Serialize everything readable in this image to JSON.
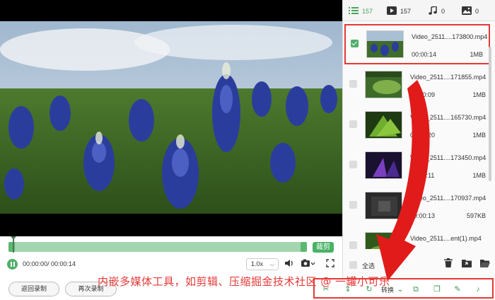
{
  "player": {
    "trim_label": "裁剪",
    "time_display": "00:00:00/ 00:00:14",
    "speed_value": "1.0x",
    "speed_caret": "⌵"
  },
  "buttons": {
    "back_record": "返回录制",
    "record_again": "再次录制"
  },
  "panel": {
    "tabs": [
      {
        "name": "all",
        "count": "157"
      },
      {
        "name": "video",
        "count": "157"
      },
      {
        "name": "audio",
        "count": "0"
      },
      {
        "name": "image",
        "count": "0"
      }
    ],
    "items": [
      {
        "name": "Video_2511....173800.mp4",
        "duration": "00:00:14",
        "size": "1MB",
        "checked": true
      },
      {
        "name": "Video_2511....171855.mp4",
        "duration": "00:00:09",
        "size": "1MB",
        "checked": false
      },
      {
        "name": "Video_2511....165730.mp4",
        "duration": "00:00:20",
        "size": "1MB",
        "checked": false
      },
      {
        "name": "Video_2511....173450.mp4",
        "duration": "00:00:11",
        "size": "1MB",
        "checked": false
      },
      {
        "name": "Video_2511....170937.mp4",
        "duration": "00:00:13",
        "size": "597KB",
        "checked": false
      },
      {
        "name": "Video_2511....ent(1).mp4",
        "duration": "",
        "size": "",
        "checked": false
      }
    ],
    "select_all": "全选"
  },
  "toolbar": {
    "convert_label": "转换"
  },
  "overlay": {
    "caption": "内嵌多媒体工具，如剪辑、压缩掘金技术社区 @ 一罐小可乐"
  },
  "colors": {
    "accent": "#4fb06b",
    "highlight": "#e53935"
  }
}
